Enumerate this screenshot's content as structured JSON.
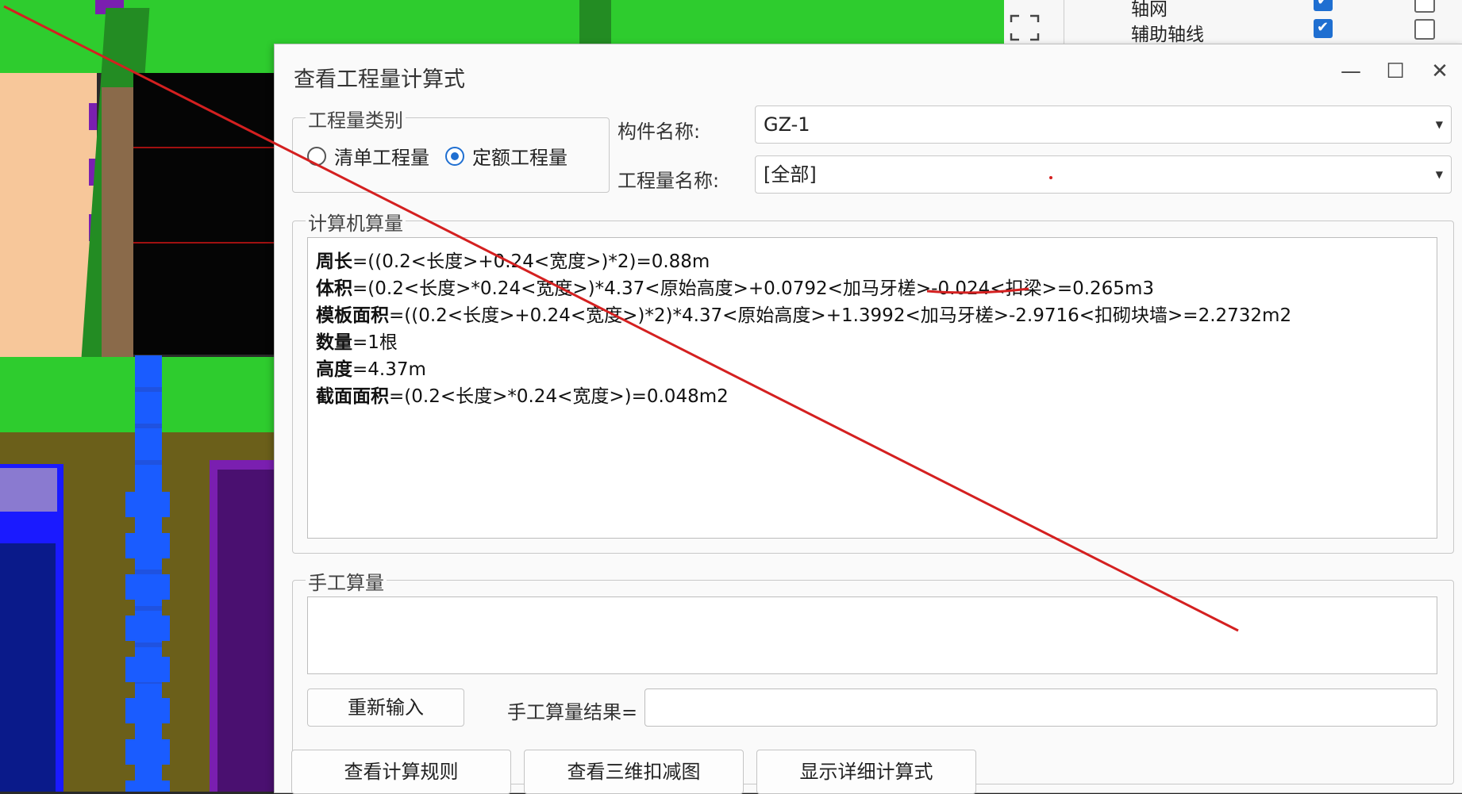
{
  "viewport": {
    "colors": {
      "green": "#2ecc2e",
      "dark_green": "#238c23",
      "black": "#050505",
      "peach": "#f7c79a",
      "olive": "#6b5f1a",
      "blue": "#1a5cff",
      "purple": "#7a1fb0",
      "navy": "#0a1a8a",
      "brown": "#8a6a4a"
    }
  },
  "right_panel": {
    "rows": [
      {
        "label": "轴网",
        "checked": true,
        "checked2": false
      },
      {
        "label": "辅助轴线",
        "checked": true,
        "checked2": false
      }
    ]
  },
  "dialog": {
    "title": "查看工程量计算式",
    "window_buttons": {
      "minimize": "—",
      "maximize": "☐",
      "close": "✕"
    },
    "category": {
      "legend": "工程量类别",
      "options": [
        {
          "label": "清单工程量",
          "selected": false
        },
        {
          "label": "定额工程量",
          "selected": true
        }
      ]
    },
    "component_name": {
      "label": "构件名称:",
      "value": "GZ-1"
    },
    "quantity_name": {
      "label": "工程量名称:",
      "value": "[全部]"
    },
    "computer_calc": {
      "legend": "计算机算量",
      "lines": [
        {
          "name": "周长",
          "expr": "=((0.2<长度>+0.24<宽度>)*2)=0.88m"
        },
        {
          "name": "体积",
          "expr": "=(0.2<长度>*0.24<宽度>)*4.37<原始高度>+0.0792<加马牙槎>-0.024<扣梁>=0.265m3"
        },
        {
          "name": "模板面积",
          "expr": "=((0.2<长度>+0.24<宽度>)*2)*4.37<原始高度>+1.3992<加马牙槎>-2.9716<扣砌块墙>=2.2732m2"
        },
        {
          "name": "数量",
          "expr": "=1根"
        },
        {
          "name": "高度",
          "expr": "=4.37m"
        },
        {
          "name": "截面面积",
          "expr": "=(0.2<长度>*0.24<宽度>)=0.048m2"
        }
      ]
    },
    "manual_calc": {
      "legend": "手工算量",
      "reenter_button": "重新输入",
      "result_label": "手工算量结果=",
      "result_value": ""
    },
    "bottom_buttons": {
      "view_rules": "查看计算规则",
      "view_3d": "查看三维扣减图",
      "show_detail": "显示详细计算式"
    }
  },
  "annotation_color": "#d42020"
}
